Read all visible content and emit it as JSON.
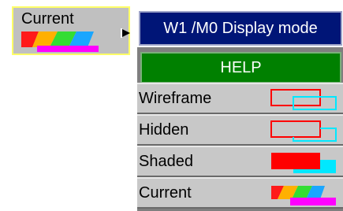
{
  "current_tile": {
    "label": "Current"
  },
  "title_bar": {
    "title": "W1 /M0 Display mode"
  },
  "help_button": {
    "label": "HELP"
  },
  "modes": [
    {
      "label": "Wireframe",
      "icon": "wireframe-icon"
    },
    {
      "label": "Hidden",
      "icon": "hidden-icon"
    },
    {
      "label": "Shaded",
      "icon": "shaded-icon"
    },
    {
      "label": "Current",
      "icon": "current-icon"
    }
  ],
  "colors": {
    "title_bg": "#001577",
    "help_bg": "#008000",
    "row_bg": "#c8c8c8",
    "tile_border": "#ffff66",
    "wire_red": "#ff0000",
    "wire_cyan": "#00e8ff"
  }
}
